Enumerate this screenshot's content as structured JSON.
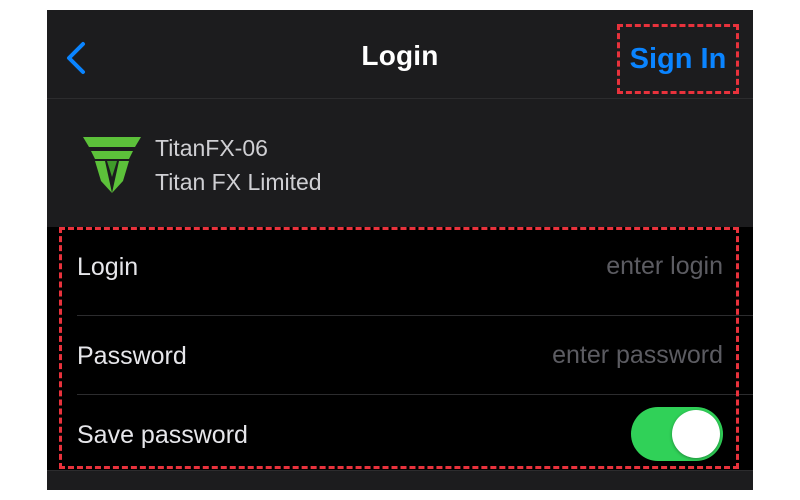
{
  "navbar": {
    "back_icon": "chevron-left-icon",
    "title": "Login",
    "sign_in_label": "Sign In"
  },
  "server": {
    "logo_icon": "titanfx-logo-icon",
    "name": "TitanFX-06",
    "company": "Titan FX Limited"
  },
  "form": {
    "login": {
      "label": "Login",
      "placeholder": "enter login",
      "value": ""
    },
    "password": {
      "label": "Password",
      "placeholder": "enter password",
      "value": ""
    },
    "save_password": {
      "label": "Save password",
      "enabled": true
    }
  },
  "colors": {
    "accent": "#0a84ff",
    "toggle_on": "#30d158",
    "highlight": "#e8323c",
    "logo_green": "#5cc13a"
  }
}
